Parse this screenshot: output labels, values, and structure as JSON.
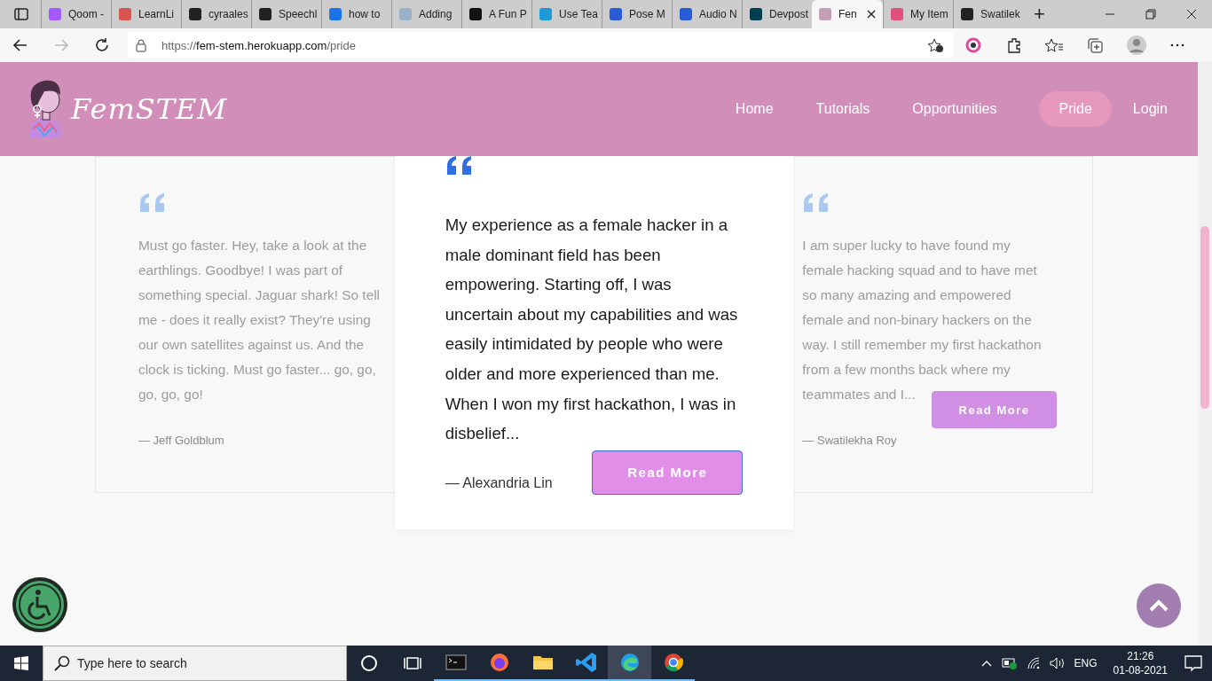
{
  "browser": {
    "tabs": [
      {
        "title": "Qoom -",
        "selected": false,
        "color": "#a259ff"
      },
      {
        "title": "LearnLi",
        "selected": false,
        "color": "#d9534f"
      },
      {
        "title": "cyraales",
        "selected": false,
        "color": "#222222"
      },
      {
        "title": "Speechl",
        "selected": false,
        "color": "#222222"
      },
      {
        "title": "how to",
        "selected": false,
        "color": "#1a73e8"
      },
      {
        "title": "Adding",
        "selected": false,
        "color": "#9ab0c8"
      },
      {
        "title": "A Fun P",
        "selected": false,
        "color": "#111111"
      },
      {
        "title": "Use Tea",
        "selected": false,
        "color": "#1e9bd7"
      },
      {
        "title": "Pose M",
        "selected": false,
        "color": "#2a5bd7"
      },
      {
        "title": "Audio N",
        "selected": false,
        "color": "#2a5bd7"
      },
      {
        "title": "Devpost",
        "selected": false,
        "color": "#003e54"
      },
      {
        "title": "Fen",
        "selected": true,
        "color": "#c7a0b8"
      },
      {
        "title": "My Item",
        "selected": false,
        "color": "#e0507a"
      },
      {
        "title": "Swatilek",
        "selected": false,
        "color": "#222222"
      }
    ],
    "new_tab": "+",
    "url": {
      "scheme": "https://",
      "host": "fem-stem.herokuapp.com",
      "path": "/pride"
    }
  },
  "site": {
    "logo": "FemSTEM",
    "nav": [
      {
        "label": "Home",
        "selected": false
      },
      {
        "label": "Tutorials",
        "selected": false
      },
      {
        "label": "Opportunities",
        "selected": false
      },
      {
        "label": "Pride",
        "selected": true
      },
      {
        "label": "Login",
        "selected": false
      }
    ]
  },
  "testimonials": [
    {
      "active": false,
      "quote": "Must go faster. Hey, take a look at the earthlings. Goodbye! I was part of something special. Jaguar shark! So tell me - does it really exist? They're using our own satellites against us. And the clock is ticking. Must go faster... go, go, go, go, go!",
      "author": "— Jeff Goldblum"
    },
    {
      "active": true,
      "quote": "My experience as a female hacker in a male dominant field has been empowering. Starting off, I was uncertain about my capabilities and was easily intimidated by people who were older and more experienced than me. When I won my first hackathon, I was in disbelief...",
      "author": "— Alexandria Lin",
      "button": "Read More"
    },
    {
      "active": false,
      "quote": "I am super lucky to have found my female hacking squad and to have met so many amazing and empowered female and non-binary hackers on the way. I still remember my first hackathon from a few months back where my teammates and I...",
      "author": "— Swatilekha Roy",
      "button": "Read More"
    }
  ],
  "taskbar": {
    "search": {
      "placeholder": "Type here to search"
    },
    "language": "ENG",
    "time": "21:26",
    "date": "01-08-2021"
  }
}
